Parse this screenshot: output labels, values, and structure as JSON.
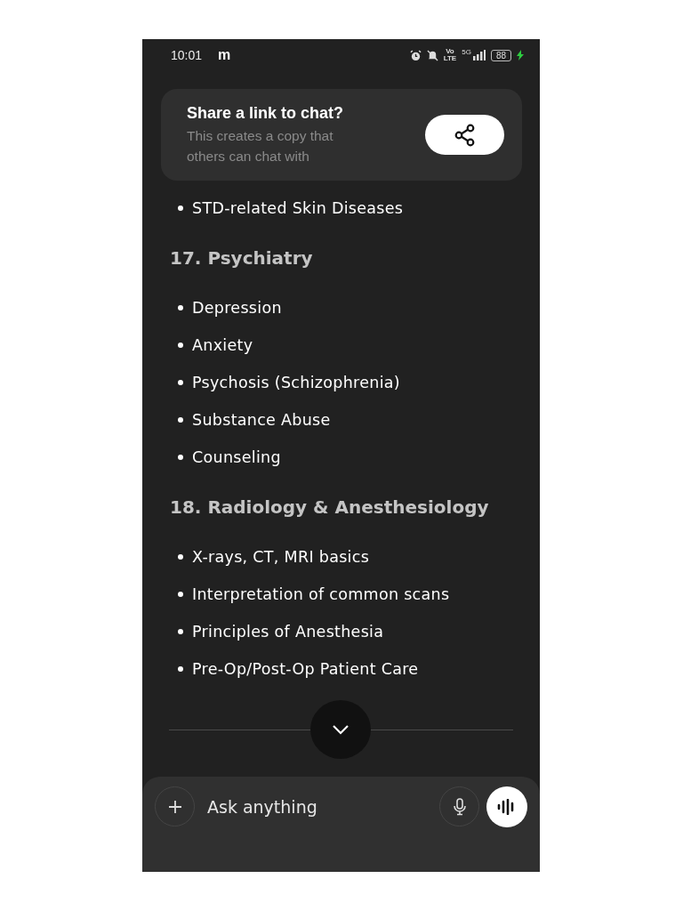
{
  "status_bar": {
    "time": "10:01",
    "app_mark": "m",
    "volte": [
      "Vo",
      "LTE"
    ],
    "network": "5G",
    "battery": "88",
    "charging": true
  },
  "share_banner": {
    "title": "Share a link to chat?",
    "subtitle": "This creates a copy that others can chat with"
  },
  "content": [
    {
      "kind": "bullet",
      "text": "STD-related Skin Diseases"
    },
    {
      "kind": "heading",
      "text": "17. Psychiatry"
    },
    {
      "kind": "bullet",
      "text": "Depression"
    },
    {
      "kind": "bullet",
      "text": "Anxiety"
    },
    {
      "kind": "bullet",
      "text": "Psychosis (Schizophrenia)"
    },
    {
      "kind": "bullet",
      "text": "Substance Abuse"
    },
    {
      "kind": "bullet",
      "text": "Counseling"
    },
    {
      "kind": "heading",
      "text": "18. Radiology & Anesthesiology"
    },
    {
      "kind": "bullet",
      "text": "X-rays, CT, MRI basics"
    },
    {
      "kind": "bullet",
      "text": "Interpretation of common scans"
    },
    {
      "kind": "bullet",
      "text": "Principles of Anesthesia"
    },
    {
      "kind": "bullet",
      "text": "Pre-Op/Post-Op Patient Care"
    }
  ],
  "composer": {
    "placeholder": "Ask anything"
  }
}
